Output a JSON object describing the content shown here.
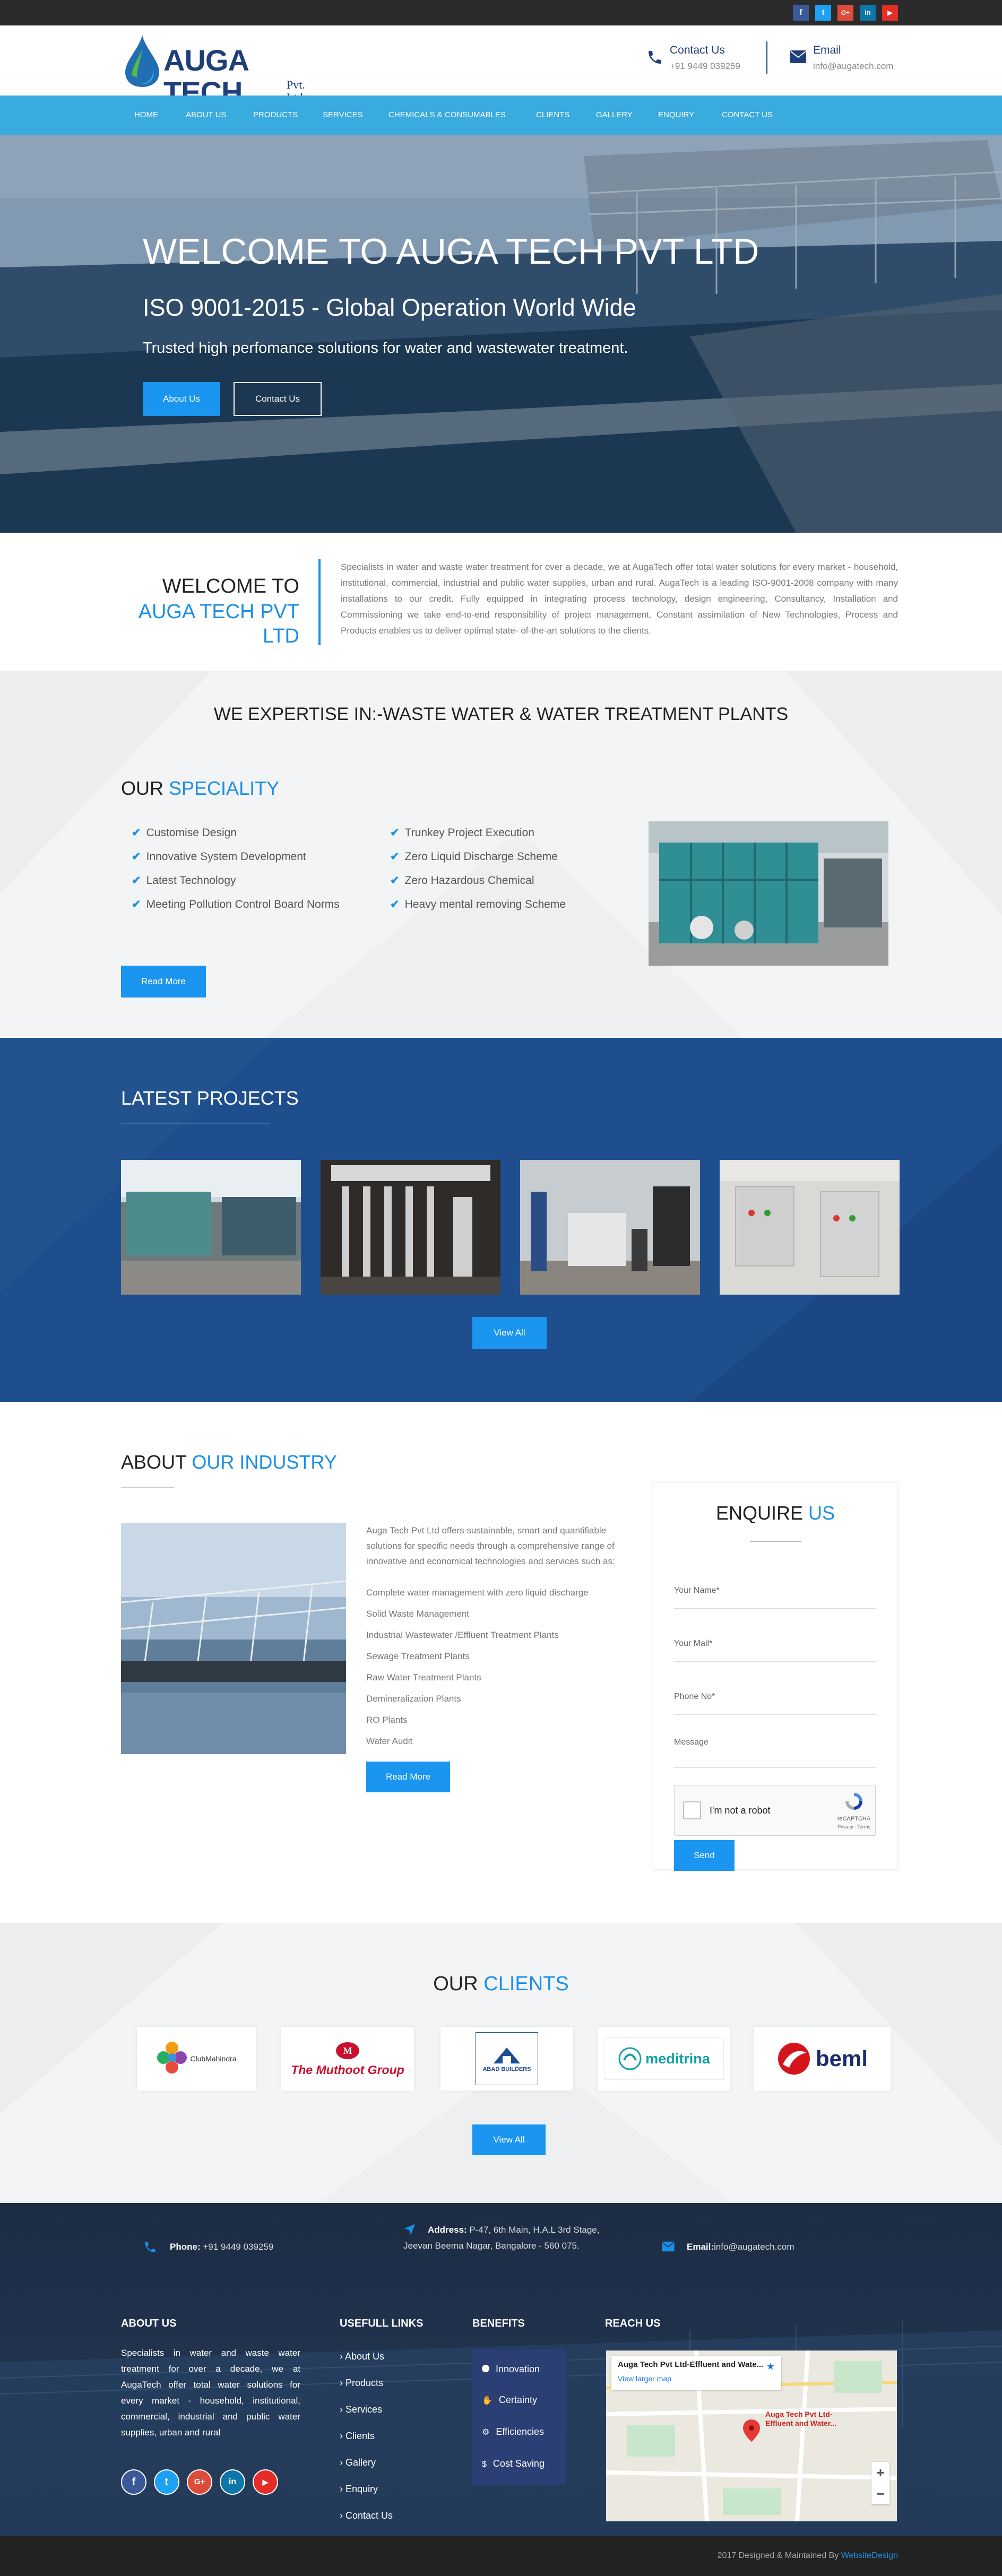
{
  "topbar": {
    "social": [
      "f",
      "t",
      "G+",
      "in",
      "▶"
    ]
  },
  "header": {
    "logo_main": "AUGA TECH",
    "logo_sub": "Pvt. Ltd",
    "contact_label": "Contact Us",
    "contact_value": "+91 9449 039259",
    "email_label": "Email",
    "email_value": "info@augatech.com"
  },
  "nav": [
    "HOME",
    "ABOUT US",
    "PRODUCTS",
    "SERVICES",
    "CHEMICALS & CONSUMABLES",
    "CLIENTS",
    "GALLERY",
    "ENQUIRY",
    "CONTACT US"
  ],
  "hero": {
    "title": "WELCOME TO AUGA TECH PVT LTD",
    "subtitle": "ISO 9001-2015 - Global Operation World Wide",
    "tagline": "Trusted high perfomance solutions for water and wastewater treatment.",
    "btn_about": "About Us",
    "btn_contact": "Contact Us"
  },
  "welcome": {
    "line1": "WELCOME TO",
    "line2": "AUGA TECH PVT LTD",
    "text": "Specialists in water and waste water treatment for over a decade, we at AugaTech offer total water solutions for every market - household, institutional, commercial, industrial and public water supplies, urban and rural. AugaTech is a leading ISO-9001-2008 company with many installations to our credit. Fully equipped in integrating process technology, design engineering, Consultancy, Installation and Commissioning we take end-to-end responsibility of project management. Constant assimilation of New Technologies, Process and Products enables us to deliver optimal state- of-the-art solutions to the clients."
  },
  "expertise": {
    "heading": "WE EXPERTISE IN:-WASTE WATER & WATER TREATMENT PLANTS",
    "our": "OUR",
    "speciality": "SPECIALITY",
    "col1": [
      "Customise Design",
      "Innovative System Development",
      "Latest Technology",
      "Meeting Pollution Control Board Norms"
    ],
    "col2": [
      "Trunkey Project Execution",
      "Zero Liquid Discharge Scheme",
      "Zero Hazardous Chemical",
      "Heavy mental removing Scheme"
    ],
    "read_more": "Read More"
  },
  "projects": {
    "heading": "LATEST PROJECTS",
    "view_all": "View All"
  },
  "about": {
    "about": "ABOUT",
    "our_industry": "OUR INDUSTRY",
    "text": "Auga Tech Pvt Ltd offers sustainable, smart and quantifiable solutions for specific needs through a comprehensive range of innovative and economical technologies and services such as:",
    "services": [
      "Complete water management with zero liquid discharge",
      "Solid Waste Management",
      "Industrial Wastewater /Effluent Treatment Plants",
      "Sewage Treatment Plants",
      "Raw Water Treatment Plants",
      "Demineralization Plants",
      "RO Plants",
      "Water Audit"
    ],
    "read_more": "Read More"
  },
  "enquire": {
    "title1": "ENQUIRE",
    "title2": "US",
    "name_ph": "Your Name*",
    "mail_ph": "Your Mail*",
    "phone_ph": "Phone No*",
    "message_ph": "Message",
    "captcha": "I'm not a robot",
    "captcha_brand": "reCAPTCHA",
    "captcha_terms": "Privacy - Terms",
    "send": "Send"
  },
  "clients": {
    "our": "OUR",
    "clients": "CLIENTS",
    "logos": [
      "ClubMahindra",
      "The Muthoot Group",
      "ABAD BUILDERS",
      "meditrina",
      "beml"
    ],
    "view_all": "View All"
  },
  "footer": {
    "phone_label": "Phone:",
    "phone_value": "+91 9449 039259",
    "address_label": "Address:",
    "address_value": "P-47, 6th Main, H.A.L 3rd Stage, Jeevan Beema Nagar, Bangalore - 560 075.",
    "email_label": "Email:",
    "email_value": "info@augatech.com",
    "about_h": "ABOUT US",
    "about_text": "Specialists in water and waste water treatment for over a decade, we at AugaTech offer total water solutions for every market - household, institutional, commercial, industrial and public water supplies, urban and rural",
    "links_h": "USEFULL LINKS",
    "links": [
      "About Us",
      "Products",
      "Services",
      "Clients",
      "Gallery",
      "Enquiry",
      "Contact Us"
    ],
    "benefits_h": "BENEFITS",
    "benefits": [
      "Innovation",
      "Certainty",
      "Efficiencies",
      "Cost Saving"
    ],
    "reach_h": "REACH US",
    "map_title": "Auga Tech Pvt Ltd-Effluent and Wate...",
    "map_link": "View larger map",
    "map_pin": "Auga Tech Pvt Ltd-Effluent and Water...",
    "copyright": "2017 Designed & Maintained By",
    "designer": "WebsiteDesign"
  }
}
